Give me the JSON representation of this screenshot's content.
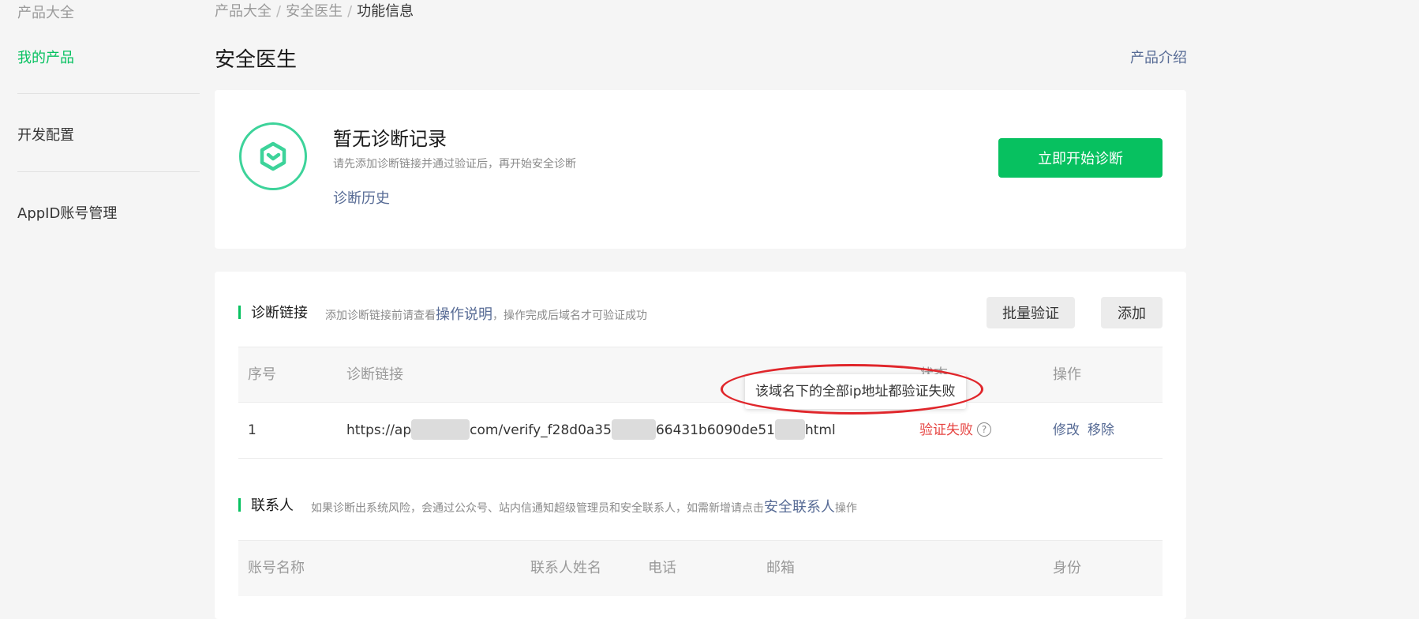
{
  "sidebar": {
    "items": [
      {
        "label": "产品大全"
      },
      {
        "label": "我的产品"
      },
      {
        "label": "开发配置"
      },
      {
        "label": "AppID账号管理"
      }
    ]
  },
  "breadcrumb": {
    "items": [
      "产品大全",
      "安全医生"
    ],
    "separator": "/",
    "current": "功能信息"
  },
  "header": {
    "title": "安全医生",
    "intro_link": "产品介绍"
  },
  "diagnosis": {
    "title": "暂无诊断记录",
    "description": "请先添加诊断链接并通过验证后，再开始安全诊断",
    "history_link": "诊断历史",
    "start_button": "立即开始诊断"
  },
  "links_section": {
    "title": "诊断链接",
    "desc_prefix": "添加诊断链接前请查看",
    "desc_link": "操作说明",
    "desc_suffix": "，操作完成后域名才可验证成功",
    "batch_button": "批量验证",
    "add_button": "添加",
    "columns": [
      "序号",
      "诊断链接",
      "状态",
      "操作"
    ],
    "rows": [
      {
        "index": "1",
        "url_part1": "https://ap",
        "url_part2": "com/verify_f28d0a35",
        "url_part3": "66431b6090de51",
        "url_part4": "html",
        "status": "验证失败",
        "status_help_icon": "question-circle-icon",
        "edit": "修改",
        "remove": "移除"
      }
    ],
    "tooltip": "该域名下的全部ip地址都验证失败"
  },
  "contacts_section": {
    "title": "联系人",
    "desc_prefix": "如果诊断出系统风险，会通过公众号、站内信通知超级管理员和安全联系人，如需新增请点击",
    "desc_link": "安全联系人",
    "desc_suffix": "操作",
    "columns": [
      "账号名称",
      "联系人姓名",
      "电话",
      "邮箱",
      "身份"
    ]
  },
  "colors": {
    "accent_green": "#07c160",
    "link_blue": "#576b95",
    "error_red": "#e64340",
    "annotation_red": "#e0262b"
  }
}
